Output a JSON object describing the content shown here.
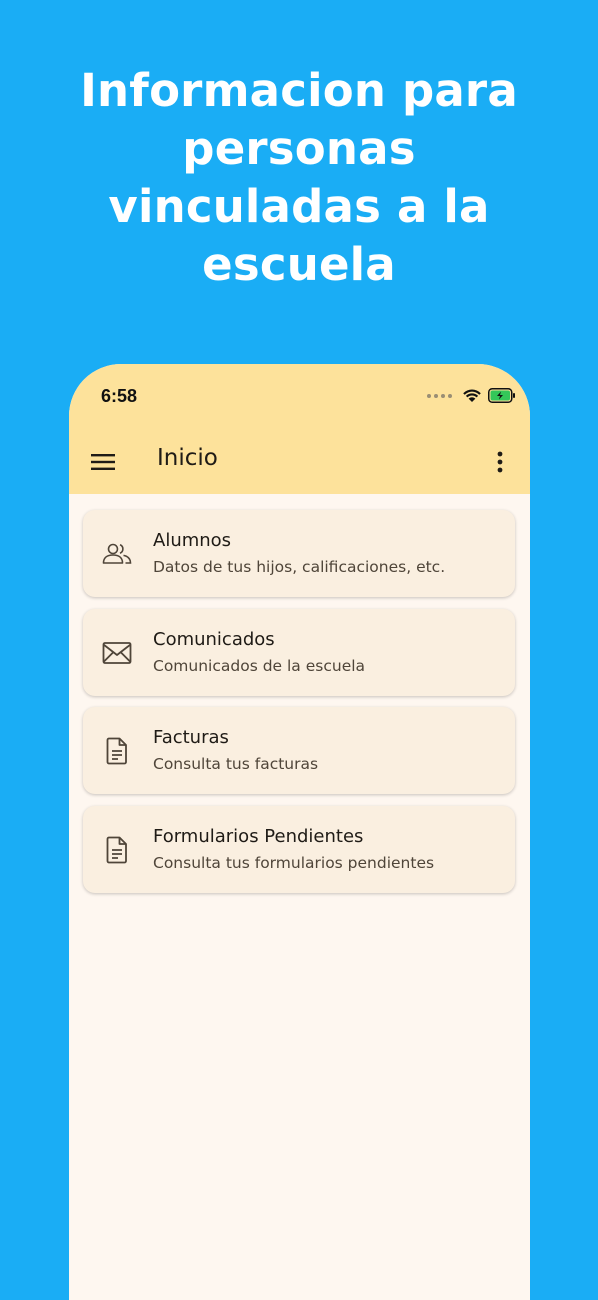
{
  "headline": {
    "lines": [
      "Informacion para",
      "personas",
      "vinculadas a la",
      "escuela"
    ]
  },
  "status_bar": {
    "time": "6:58"
  },
  "app_bar": {
    "title": "Inicio"
  },
  "cards": [
    {
      "title": "Alumnos",
      "subtitle": "Datos de tus hijos, calificaciones, etc.",
      "icon": "people-icon"
    },
    {
      "title": "Comunicados",
      "subtitle": "Comunicados de la escuela",
      "icon": "mail-icon"
    },
    {
      "title": "Facturas",
      "subtitle": "Consulta tus facturas",
      "icon": "document-icon"
    },
    {
      "title": "Formularios Pendientes",
      "subtitle": "Consulta tus formularios pendientes",
      "icon": "document-icon"
    }
  ],
  "colors": {
    "background": "#1aadf5",
    "app_bar": "#fde29b",
    "surface": "#fef7f0",
    "card": "#faefe0",
    "battery": "#34c759"
  }
}
